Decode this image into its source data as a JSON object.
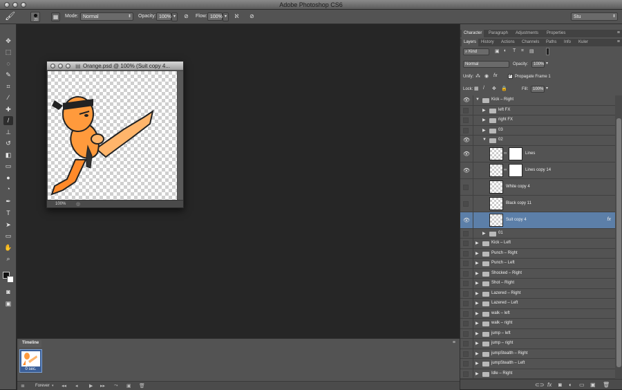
{
  "app": {
    "title": "Adobe Photoshop CS6",
    "workspace": "Stu"
  },
  "options_bar": {
    "brush_size": "20",
    "mode_label": "Mode:",
    "mode_value": "Normal",
    "opacity_label": "Opacity:",
    "opacity_value": "100%",
    "flow_label": "Flow:",
    "flow_value": "100%"
  },
  "toolbar": {
    "tools": [
      "move-tool",
      "marquee-tool",
      "lasso-tool",
      "quick-select-tool",
      "crop-tool",
      "eyedropper-tool",
      "healing-brush-tool",
      "brush-tool",
      "clone-stamp-tool",
      "history-brush-tool",
      "eraser-tool",
      "gradient-tool",
      "blur-tool",
      "dodge-tool",
      "pen-tool",
      "type-tool",
      "path-select-tool",
      "shape-tool",
      "hand-tool",
      "zoom-tool"
    ],
    "active_tool": "brush-tool"
  },
  "document": {
    "title": "Orange.psd @ 100% (Suit copy 4...",
    "zoom": "100%"
  },
  "timeline": {
    "tab": "Timeline",
    "frame_delay": "0 sec.",
    "loop": "Forever"
  },
  "panels": {
    "top_tabs": [
      "Character",
      "Paragraph",
      "Adjustments",
      "Properties"
    ],
    "layer_tabs": [
      "Layers",
      "History",
      "Actions",
      "Channels",
      "Paths",
      "Info",
      "Kuler"
    ],
    "filter_kind": "Kind",
    "blend_mode": "Normal",
    "opacity_label": "Opacity:",
    "opacity_value": "100%",
    "unify_label": "Unify:",
    "propagate_label": "Propagate Frame 1",
    "lock_label": "Lock:",
    "fill_label": "Fill:",
    "fill_value": "100%"
  },
  "layers": [
    {
      "name": "Kick – Right",
      "type": "group",
      "indent": 0,
      "open": true,
      "visible": true
    },
    {
      "name": "left FX",
      "type": "group",
      "indent": 1,
      "open": false,
      "visible": false
    },
    {
      "name": "right FX",
      "type": "group",
      "indent": 1,
      "open": false,
      "visible": false
    },
    {
      "name": "03",
      "type": "group",
      "indent": 1,
      "open": false,
      "visible": false
    },
    {
      "name": "02",
      "type": "group",
      "indent": 1,
      "open": true,
      "visible": true
    },
    {
      "name": "Lines",
      "type": "layer",
      "indent": 2,
      "visible": true,
      "mask": true
    },
    {
      "name": "Lines copy 14",
      "type": "layer",
      "indent": 2,
      "visible": true,
      "mask": true
    },
    {
      "name": "White copy 4",
      "type": "layer",
      "indent": 2,
      "visible": false
    },
    {
      "name": "Black copy 11",
      "type": "layer",
      "indent": 2,
      "visible": false
    },
    {
      "name": "Suit copy 4",
      "type": "layer",
      "indent": 2,
      "visible": true,
      "selected": true,
      "fx": "fx"
    },
    {
      "name": "01",
      "type": "group",
      "indent": 1,
      "open": false,
      "visible": false
    },
    {
      "name": "Kick – Left",
      "type": "group",
      "indent": 0,
      "visible": false
    },
    {
      "name": "Punch – Right",
      "type": "group",
      "indent": 0,
      "visible": false
    },
    {
      "name": "Punch – Left",
      "type": "group",
      "indent": 0,
      "visible": false
    },
    {
      "name": "Shocked – Right",
      "type": "group",
      "indent": 0,
      "visible": false
    },
    {
      "name": "Shot – Right",
      "type": "group",
      "indent": 0,
      "visible": false
    },
    {
      "name": "Lazered – Right",
      "type": "group",
      "indent": 0,
      "visible": false
    },
    {
      "name": "Lazered – Left",
      "type": "group",
      "indent": 0,
      "visible": false
    },
    {
      "name": "walk – left",
      "type": "group",
      "indent": 0,
      "visible": false
    },
    {
      "name": "walk – right",
      "type": "group",
      "indent": 0,
      "visible": false
    },
    {
      "name": "jump – left",
      "type": "group",
      "indent": 0,
      "visible": false
    },
    {
      "name": "jump – right",
      "type": "group",
      "indent": 0,
      "visible": false
    },
    {
      "name": "jumpStealth – Right",
      "type": "group",
      "indent": 0,
      "visible": false
    },
    {
      "name": "jumpStealth – Left",
      "type": "group",
      "indent": 0,
      "visible": false
    },
    {
      "name": "Idle – Right",
      "type": "group",
      "indent": 0,
      "visible": false
    }
  ],
  "colors": {
    "selection": "#5c7fa8",
    "panel": "#535353",
    "workspace": "#262626"
  }
}
